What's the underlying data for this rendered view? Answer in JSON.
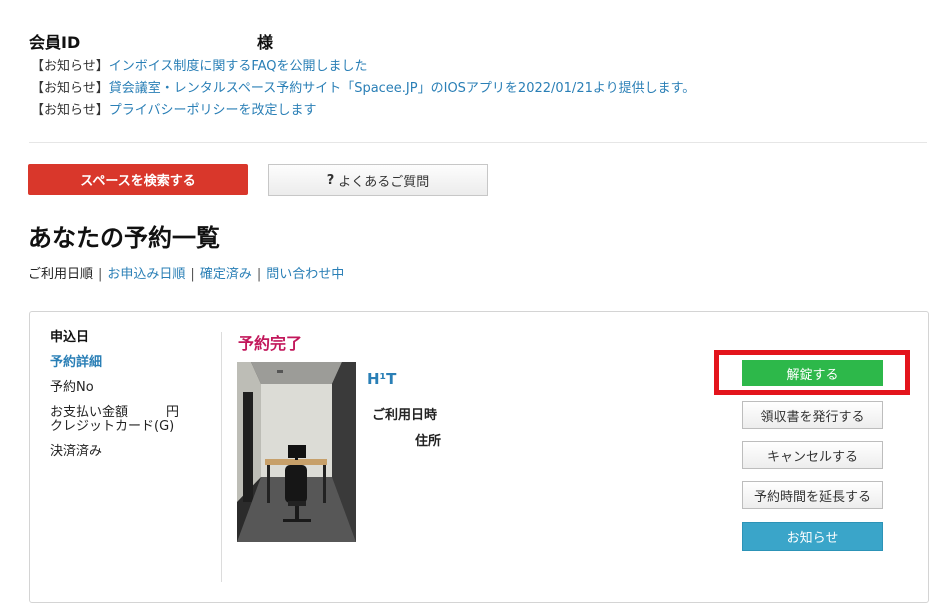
{
  "header": {
    "member_label": "会員ID",
    "honorific": "様"
  },
  "notices": [
    {
      "tag": "【お知らせ】",
      "text": "インボイス制度に関するFAQを公開しました"
    },
    {
      "tag": "【お知らせ】",
      "text": "貸会議室・レンタルスペース予約サイト「Spacee.JP」のIOSアプリを2022/01/21より提供します。"
    },
    {
      "tag": "【お知らせ】",
      "text": "プライバシーポリシーを改定します"
    }
  ],
  "actions": {
    "search_label": "スペースを検索する",
    "faq_icon": "?",
    "faq_label": "よくあるご質問"
  },
  "page_title": "あなたの予約一覧",
  "sort": {
    "current": "ご利用日順",
    "links": [
      "お申込み日順",
      "確定済み",
      "問い合わせ中"
    ],
    "separator": "|"
  },
  "reservation": {
    "applied_label": "申込日",
    "detail_link": "予約詳細",
    "number_label": "予約No",
    "payment_label": "お支払い金額",
    "currency": "円",
    "payment_method": "クレジットカード(G)",
    "payment_status": "決済済み",
    "status": "予約完了",
    "space_name": "H¹T",
    "date_label": "ご利用日時",
    "address_label": "住所",
    "buttons": {
      "unlock": "解錠する",
      "receipt": "領収書を発行する",
      "cancel": "キャンセルする",
      "extend": "予約時間を延長する",
      "notice": "お知らせ"
    },
    "colors": {
      "status": "#c2185b",
      "unlock_bg": "#2db84a",
      "highlight_border": "#e3141c",
      "notice_bg": "#3aa5c9",
      "search_bg": "#d9372b",
      "link": "#2a7fb6"
    }
  }
}
